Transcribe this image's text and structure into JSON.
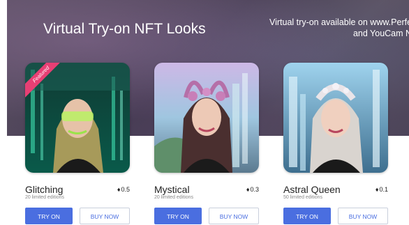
{
  "banner": {
    "title": "Virtual Try-on NFT Looks",
    "note_line1": "Virtual try-on available on www.Perfe",
    "note_line2": "and YouCam N"
  },
  "cards": [
    {
      "name": "Glitching",
      "badge": "Featured",
      "price": "0.5",
      "editions": "20 limited editions",
      "try_label": "TRY ON",
      "buy_label": "BUY NOW"
    },
    {
      "name": "Mystical",
      "price": "0.3",
      "editions": "20 limited editions",
      "try_label": "TRY ON",
      "buy_label": "BUY NOW"
    },
    {
      "name": "Astral Queen",
      "price": "0.1",
      "editions": "50 limited editions",
      "try_label": "TRY ON",
      "buy_label": "BUY NOW"
    }
  ],
  "icons": {
    "price": "eth-diamond-icon"
  },
  "colors": {
    "accent": "#4a6ee0",
    "ribbon": "#e73f74",
    "banner": "#4a4156"
  }
}
